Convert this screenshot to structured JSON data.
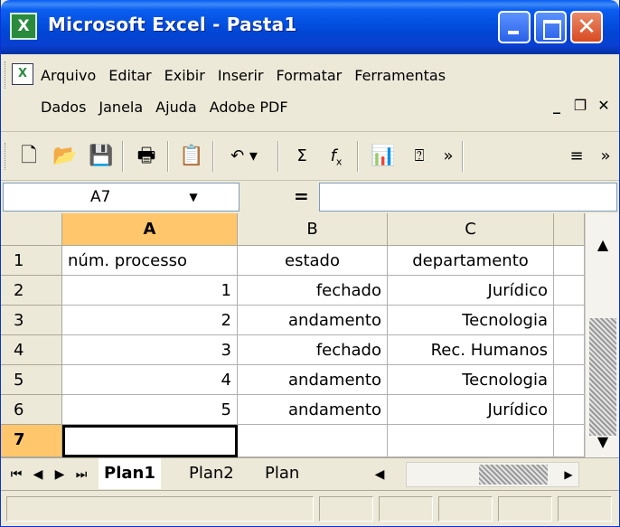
{
  "window": {
    "title": "Microsoft Excel - Pasta1",
    "app_icon": "excel-icon"
  },
  "menu": {
    "row1": [
      "Arquivo",
      "Editar",
      "Exibir",
      "Inserir",
      "Formatar",
      "Ferramentas"
    ],
    "row2": [
      "Dados",
      "Janela",
      "Ajuda",
      "Adobe PDF"
    ]
  },
  "toolbar": {
    "icons": [
      "new-icon",
      "open-icon",
      "save-icon",
      "print-icon",
      "paste-icon",
      "undo-icon",
      "sum-icon",
      "function-icon",
      "chart-wizard-icon",
      "help-icon",
      "more-icon",
      "align-icon",
      "more-icon"
    ]
  },
  "formula": {
    "namebox": "A7",
    "equals": "="
  },
  "grid": {
    "columns": [
      "A",
      "B",
      "C"
    ],
    "rows": [
      "1",
      "2",
      "3",
      "4",
      "5",
      "6",
      "7"
    ],
    "active_cell": "A7",
    "cells": [
      [
        "núm. processo",
        "estado",
        "departamento"
      ],
      [
        "1",
        "fechado",
        "Jurídico"
      ],
      [
        "2",
        "andamento",
        "Tecnologia"
      ],
      [
        "3",
        "fechado",
        "Rec. Humanos"
      ],
      [
        "4",
        "andamento",
        "Tecnologia"
      ],
      [
        "5",
        "andamento",
        "Jurídico"
      ],
      [
        "",
        "",
        ""
      ]
    ]
  },
  "sheets": {
    "tabs": [
      "Plan1",
      "Plan2",
      "Plan"
    ],
    "active": "Plan1"
  }
}
